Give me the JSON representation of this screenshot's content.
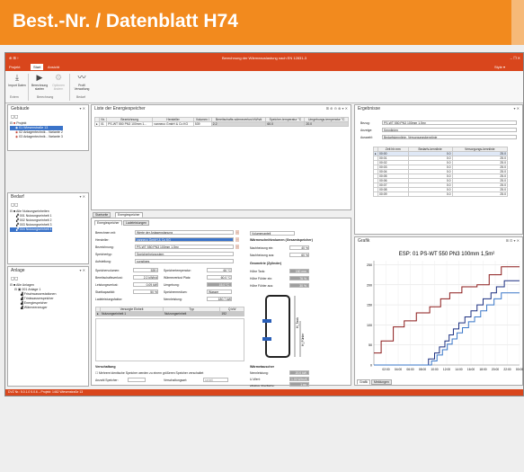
{
  "banner": {
    "title": "Best.-Nr. / Datenblatt H74"
  },
  "app": {
    "window_title": "Berechnung der Wärmeauslastung nach EN 12831-3",
    "title_left": "⊕ ⊞ ↑",
    "title_right": "– ❐ ✕",
    "style_label": "Style ▾",
    "menu": {
      "projekt": "Projekt",
      "start": "Start",
      "ansicht": "Ansicht"
    },
    "ribbon": {
      "import": "Import Daten",
      "berechnung": "Berechnung starten",
      "optionen": "Optionen ändern",
      "profil": "Profil Verwaltung",
      "grp_extern": "Extern",
      "grp_berechnung": "Berechnung",
      "grp_bedarf": "Bedarf"
    },
    "gebaeude": {
      "title": "Gebäude",
      "root": "Projekt",
      "items": [
        "01 Wiesenstraße 13",
        "02 Anlagentechnik - Variante 2",
        "03 Anlagentechnik - Variante 3"
      ]
    },
    "bedarf": {
      "title": "Bedarf",
      "root": "Alle Nutzungseinheiten",
      "items": [
        "001 Nutzungseinheit 1",
        "002 Nutzungseinheit 2",
        "003 Nutzungseinheit 3",
        "004 Nutzungseinheit 4"
      ]
    },
    "anlage": {
      "title": "Anlage",
      "root": "Alle Anlagen",
      "items": [
        "001 Anlage 1",
        "Frischwasserstationen",
        "Trinkwasserspeicher",
        "Energiespeicher",
        "Wärmeerzeuger"
      ]
    },
    "energiespeicher": {
      "title": "Liste der Energiespeicher",
      "headers": [
        "Nr.",
        "Bezeichnung",
        "Hersteller",
        "Volumen l",
        "Bereitschafts-wärmeverlust kWh/d",
        "Speicher-temperatur °C",
        "Umgebungs-temperatur °C"
      ],
      "row": [
        "01",
        "PS-WT 550 PN3 100mm 1...",
        "vanneco GmbH & Co KG",
        "539",
        "2.2",
        "60.0",
        "20.0"
      ]
    },
    "tabs": {
      "startseite": "Startseite",
      "energiespeicher": "Energiespeicher"
    },
    "subtabs": {
      "eig": "Energiespeicher",
      "ladeleistung": "Ladeleistungen"
    },
    "form": {
      "berechnen_mit": "Berechnen mit:",
      "berechnen_mit_v": "Werte der Anlagenplanung",
      "hersteller": "Hersteller:",
      "hersteller_v": "vanneco GmbH & Co KG",
      "bezeichnung": "Bezeichnung:",
      "bezeichnung_v": "PS-WT 550 PN3 100mm 1,5m²",
      "speichertyp": "Speichertyp:",
      "speichertyp_v": "Speicherheizsystem",
      "aufstellung": "Aufstellung:",
      "aufstellung_v": "sonstiges",
      "speichervolumen": "Speichervolumen:",
      "speichervolumen_v": "539 l",
      "bereitschaft": "Bereitschaftsverlust:",
      "bereitschaft_v": "2.2 kWh/d",
      "leistungsverlust": "Leistungsverlust:",
      "leistungsverlust_v": "0.09 kW",
      "startkapazitaet": "Startkapazität:",
      "startkapazitaet_v": "50 %",
      "ladeleistungsfaktor": "Ladeleistungsfaktor:",
      "speichertemp": "Speichertemperatur:",
      "speichertemp_v": "60 °C",
      "waermeverlust": "Wärmeverlust Platz:",
      "waermeverlust_v": "60.0 °C",
      "umgebung": "Umgebung:",
      "umgebung_v": "15.0 °C",
      "speichermedium": "Speichermedium:",
      "speichermedium_v": "Wasser",
      "nennleistung": "Nennleistung:",
      "nennleistung_v": "180.7 kW",
      "volumenanteil": "Volumenanteil",
      "wrv_title": "Wärmeschnittvolumen (Gesamtspeicher)",
      "nachheizung_ein": "Nachheizung ein:",
      "nachheizung_ein_v": "40 %",
      "nachheizung_aus": "Nachheizung aus:",
      "nachheizung_aus_v": "60 %",
      "geometrie": "Geometrie (Zylinder)",
      "hoehe_tank": "Höhe Tank:",
      "hoehe_tank_v": "180 mm",
      "hoehe_ein": "Höhe Fühler ein:",
      "hoehe_ein_v": "76 %",
      "hoehe_aus": "Höhe Fühler aus:",
      "hoehe_aus_v": "30 %",
      "ve_headers": [
        "Versorgte Einheit",
        "Typ",
        "Q kW"
      ],
      "ve_row": [
        "Nutzungseinheit 1",
        "Nutzungseinheit",
        "192"
      ],
      "verschaltung": "Verschaltung",
      "mehrere": "Mehrere identische Speicher werden zu einem größeren Speicher verschaltet",
      "anzahl": "Anzahl Speicher:",
      "verschaltungsart": "Verschaltungsart:",
      "verschaltungsart_v": "seriell",
      "waermetauscher": "Wärmetauscher",
      "nennleistung2": "Nennleistung:",
      "nennleistung2_v": "20.0 kW",
      "uwert": "U-Wert:",
      "uwert_v": "1.00 W/m²K",
      "oberflaeche": "effektive Oberfläche:",
      "oberflaeche_v": "1 m²",
      "h_label": "H_Tank",
      "h2_label": "H_Fühler"
    },
    "ergebnisse": {
      "title": "Ergebnisse",
      "bezug": "Bezug:",
      "bezug_v": "PS-WT 550 PN3 100mm 1,5m²",
      "anzeige": "Anzeige:",
      "anzeige_v": "Kennlinien",
      "auswahl": "Auswahl:",
      "auswahl_v": "Bedarfskennlinie, Versorgungskennlinie",
      "headers": [
        "Zeit hh:mm",
        "Bedarfs-kennlinie",
        "Versorgungs-kennlinie"
      ],
      "rows": [
        [
          "00:00",
          "0.0",
          "25.0"
        ],
        [
          "00:01",
          "0.0",
          "25.0"
        ],
        [
          "00:02",
          "0.0",
          "25.0"
        ],
        [
          "00:03",
          "0.0",
          "25.0"
        ],
        [
          "00:04",
          "0.0",
          "25.0"
        ],
        [
          "00:05",
          "0.0",
          "25.0"
        ],
        [
          "00:06",
          "0.0",
          "25.0"
        ],
        [
          "00:07",
          "0.0",
          "25.0"
        ],
        [
          "00:08",
          "0.0",
          "25.0"
        ],
        [
          "00:09",
          "0.0",
          "25.0"
        ]
      ]
    },
    "grafik": {
      "title": "Grafik",
      "tab1": "Grafik",
      "tab2": "Meldungen"
    },
    "status": "DVZ Nr.: 5.0.1.0 5.0.6 – Projekt: 1462 Wiesenstraße 13"
  },
  "chart_data": {
    "type": "line",
    "title": "ESP: 01 PS-WT 550 PN3 100mm 1,5m²",
    "xlabel": "",
    "ylabel": "",
    "x_ticks": [
      "02:00",
      "04:00",
      "06:00",
      "08:00",
      "10:00",
      "12:00",
      "14:00",
      "16:00",
      "18:00",
      "20:00",
      "22:00",
      "00:00"
    ],
    "y_ticks": [
      0,
      50,
      100,
      150,
      200,
      250
    ],
    "ylim": [
      0,
      260
    ],
    "series": [
      {
        "color": "#8b1a1a",
        "x": [
          0,
          1.2,
          1.2,
          3.2,
          3.2,
          5,
          5,
          7,
          7,
          9.2,
          9.2,
          11,
          11,
          12.5,
          12.5,
          14.5,
          14.5,
          17,
          17,
          19,
          19,
          21,
          21,
          24
        ],
        "y": [
          30,
          30,
          60,
          60,
          95,
          95,
          110,
          110,
          130,
          130,
          145,
          145,
          165,
          165,
          180,
          180,
          195,
          195,
          200,
          200,
          225,
          225,
          245,
          245
        ]
      },
      {
        "color": "#1a2f80",
        "x": [
          0,
          9,
          9,
          10,
          10,
          10.8,
          10.8,
          11.7,
          11.7,
          12.4,
          12.4,
          13.1,
          13.1,
          14,
          14,
          15,
          15,
          16,
          16,
          17,
          17,
          18,
          18,
          19.3,
          19.3,
          20.2,
          20.2,
          21.5,
          21.5,
          24
        ],
        "y": [
          0,
          0,
          15,
          15,
          30,
          30,
          45,
          45,
          60,
          60,
          75,
          75,
          90,
          90,
          105,
          105,
          120,
          120,
          135,
          135,
          150,
          150,
          165,
          165,
          180,
          180,
          195,
          195,
          210,
          210
        ]
      },
      {
        "color": "#3a77c8",
        "x": [
          0,
          9.5,
          9.5,
          10.4,
          10.4,
          11.3,
          11.3,
          12.1,
          12.1,
          12.9,
          12.9,
          13.7,
          13.7,
          14.6,
          14.6,
          15.6,
          15.6,
          16.6,
          16.6,
          17.6,
          17.6,
          18.6,
          18.6,
          19.8,
          19.8,
          21,
          21,
          24
        ],
        "y": [
          0,
          0,
          10,
          10,
          25,
          25,
          38,
          38,
          52,
          52,
          65,
          65,
          80,
          80,
          93,
          93,
          108,
          108,
          120,
          120,
          135,
          135,
          150,
          150,
          165,
          165,
          180,
          180
        ]
      }
    ]
  }
}
